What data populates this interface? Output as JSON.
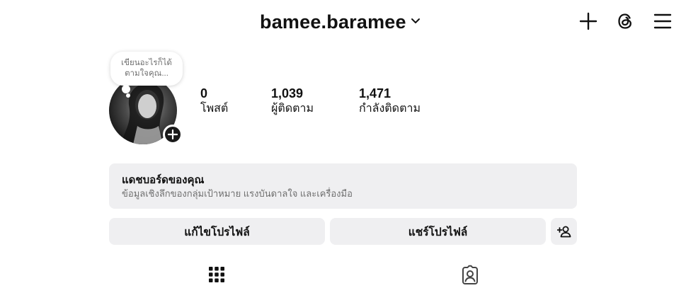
{
  "header": {
    "username": "bamee.baramee",
    "icons": [
      "chevron-down-icon",
      "plus-icon",
      "threads-icon",
      "menu-icon"
    ]
  },
  "note": {
    "line1": "เขียนอะไรก็ได้",
    "line2": "ตามใจคุณ..."
  },
  "profile": {
    "avatar": "profile-photo",
    "stats": [
      {
        "value": "0",
        "label": "โพสต์"
      },
      {
        "value": "1,039",
        "label": "ผู้ติดตาม"
      },
      {
        "value": "1,471",
        "label": "กำลังติดตาม"
      }
    ]
  },
  "dashboard": {
    "title": "แดชบอร์ดของคุณ",
    "subtitle": "ข้อมูลเชิงลึกของกลุ่มเป้าหมาย แรงบันดาลใจ และเครื่องมือ"
  },
  "actions": {
    "edit_profile": "แก้ไขโปรไฟล์",
    "share_profile": "แชร์โปรไฟล์",
    "discover_people_icon": "add-person-icon"
  },
  "tabs": [
    {
      "icon": "grid-icon",
      "active": true
    },
    {
      "icon": "tagged-icon",
      "active": false
    }
  ]
}
